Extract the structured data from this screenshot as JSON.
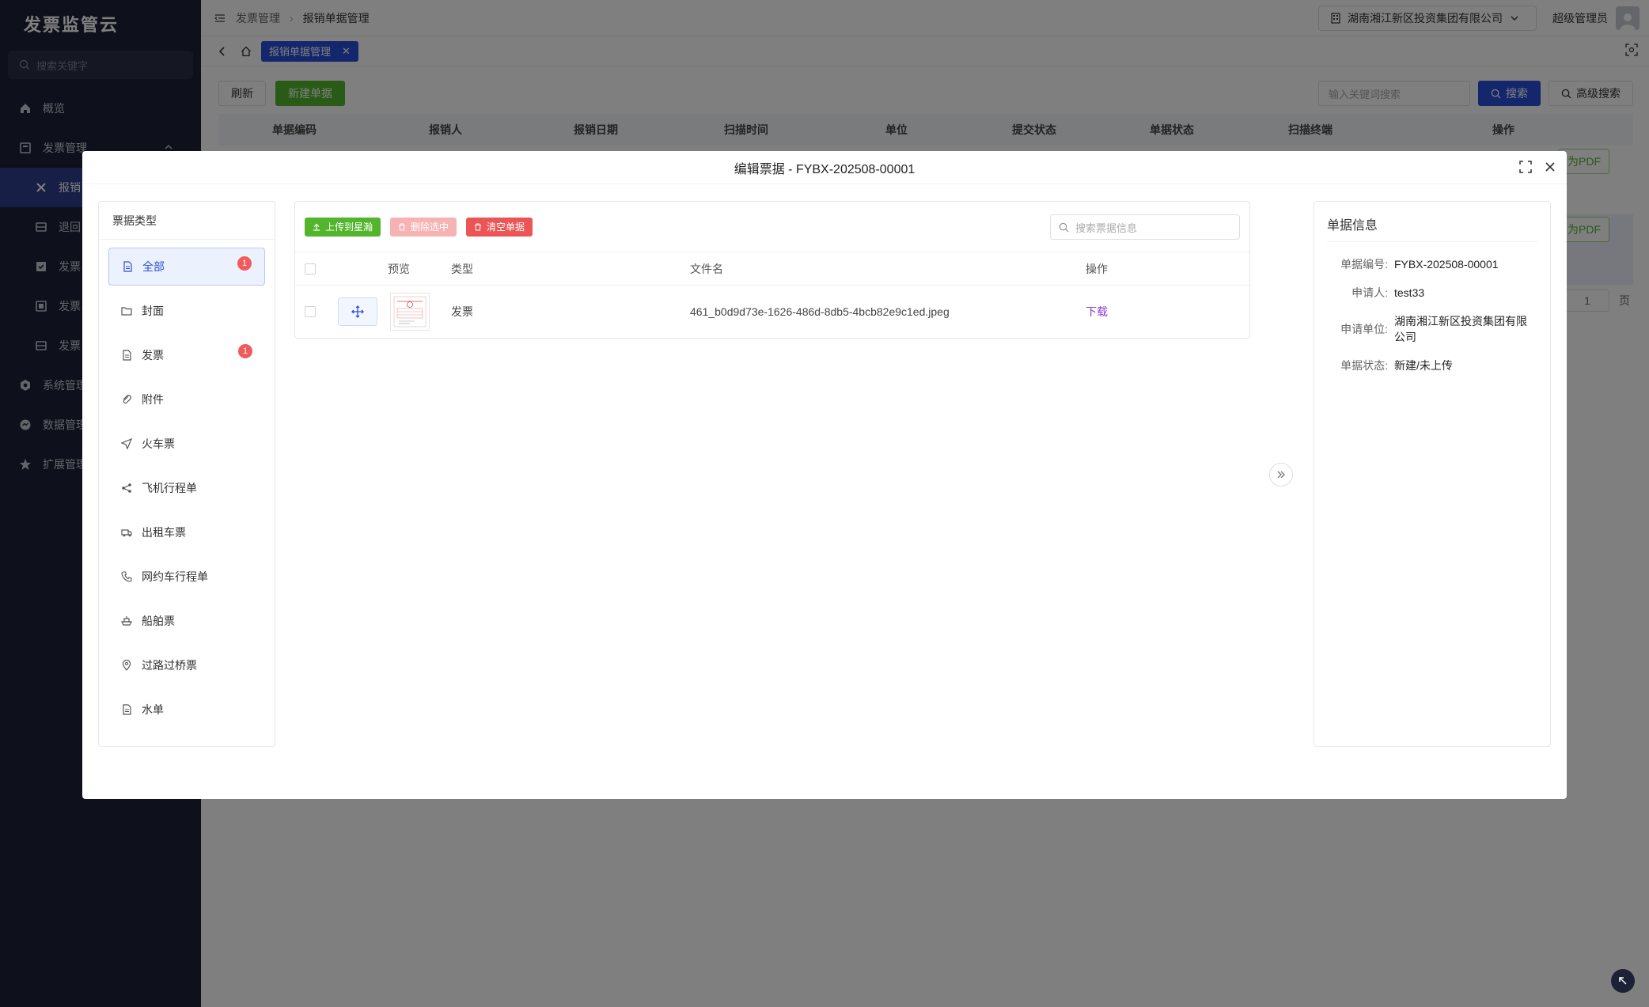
{
  "sidebar": {
    "logo": "发票监管云",
    "search_placeholder": "搜索关键字",
    "items": [
      {
        "label": "概览"
      },
      {
        "label": "发票管理"
      },
      {
        "label": "报销"
      },
      {
        "label": "退回"
      },
      {
        "label": "发票"
      },
      {
        "label": "发票"
      },
      {
        "label": "发票"
      },
      {
        "label": "系统管理"
      },
      {
        "label": "数据管理"
      },
      {
        "label": "扩展管理"
      }
    ]
  },
  "header": {
    "breadcrumb": [
      "发票管理",
      "报销单据管理"
    ],
    "company": "湖南湘江新区投资集团有限公司",
    "user": "超级管理员"
  },
  "tabs": {
    "active": "报销单据管理"
  },
  "main": {
    "refresh": "刷新",
    "new": "新建单据",
    "search_placeholder": "输入关键词搜索",
    "search": "搜索",
    "advanced": "高级搜索",
    "columns": [
      "单据编码",
      "报销人",
      "报销日期",
      "扫描时间",
      "单位",
      "提交状态",
      "单据状态",
      "扫描终端",
      "操作"
    ],
    "pdf_label": "为PDF",
    "page_value": "1",
    "page_unit": "页"
  },
  "modal": {
    "title": "编辑票据 - FYBX-202508-00001",
    "categories_title": "票据类型",
    "categories": [
      {
        "label": "全部",
        "badge": "1"
      },
      {
        "label": "封面",
        "badge": ""
      },
      {
        "label": "发票",
        "badge": "1"
      },
      {
        "label": "附件",
        "badge": ""
      },
      {
        "label": "火车票",
        "badge": ""
      },
      {
        "label": "飞机行程单",
        "badge": ""
      },
      {
        "label": "出租车票",
        "badge": ""
      },
      {
        "label": "网约车行程单",
        "badge": ""
      },
      {
        "label": "船舶票",
        "badge": ""
      },
      {
        "label": "过路过桥票",
        "badge": ""
      },
      {
        "label": "水单",
        "badge": ""
      }
    ],
    "toolbar": {
      "upload": "上传到星瀚",
      "delete_selected": "删除选中",
      "clear": "清空单据",
      "search_placeholder": "搜索票据信息"
    },
    "file_columns": {
      "preview": "预览",
      "type": "类型",
      "filename": "文件名",
      "action": "操作"
    },
    "files": [
      {
        "type": "发票",
        "filename": "461_b0d9d73e-1626-486d-8db5-4bcb82e9c1ed.jpeg",
        "action": "下载"
      }
    ],
    "info": {
      "title": "单据信息",
      "rows": [
        {
          "key": "单据编号:",
          "value": "FYBX-202508-00001"
        },
        {
          "key": "申请人:",
          "value": "test33"
        },
        {
          "key": "申请单位:",
          "value": "湖南湘江新区投资集团有限公司"
        },
        {
          "key": "单据状态:",
          "value": "新建/未上传"
        }
      ]
    }
  }
}
